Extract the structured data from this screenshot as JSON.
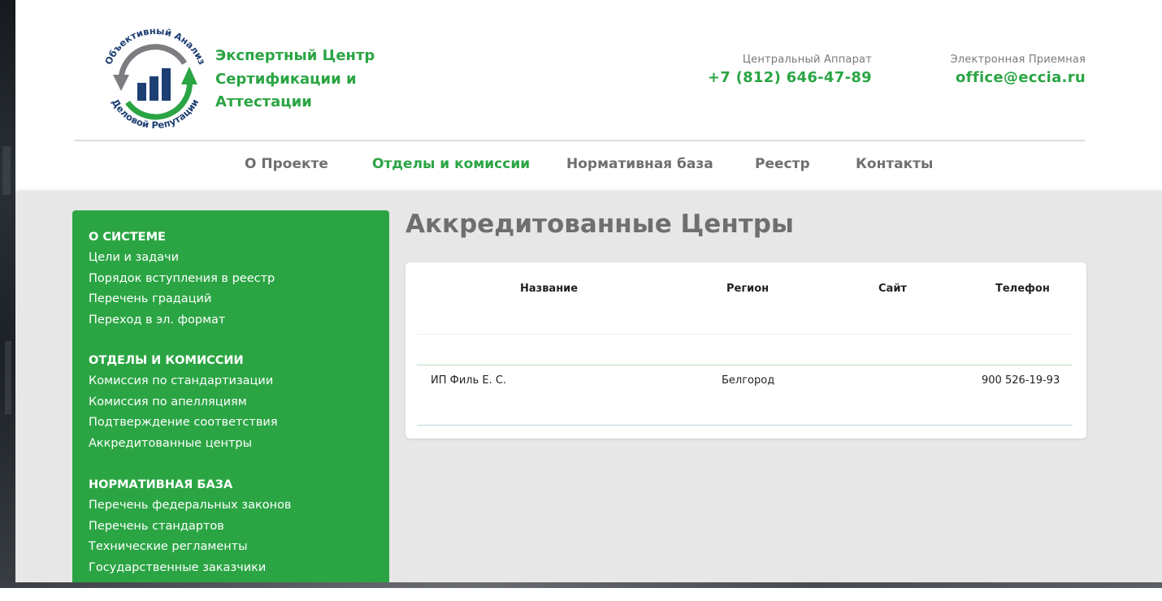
{
  "colors": {
    "brand_green": "#2ba544",
    "nav_gray": "#6f6f6f",
    "content_bg": "#e7e7e7"
  },
  "logo": {
    "icon": "circular-arrows-bar-chart-logo-icon",
    "ring_top_text": "Объективный Анализ",
    "ring_bottom_text": "Деловой Репутации"
  },
  "brand": {
    "line1": "Экспертный Центр",
    "line2": "Сертификации и",
    "line3": "Аттестации"
  },
  "contacts": {
    "phone_label": "Центральный Аппарат",
    "phone": "+7 (812) 646-47-89",
    "email_label": "Электронная Приемная",
    "email": "office@eccia.ru"
  },
  "nav": [
    {
      "label": "О Проекте",
      "active": false
    },
    {
      "label": "Отделы и комиссии",
      "active": true
    },
    {
      "label": "Нормативная база",
      "active": false
    },
    {
      "label": "Реестр",
      "active": false
    },
    {
      "label": "Контакты",
      "active": false
    }
  ],
  "sidebar": {
    "sections": [
      {
        "title": "О СИСТЕМЕ",
        "items": [
          "Цели и задачи",
          "Порядок вступления в реестр",
          "Перечень градаций",
          "Переход в эл. формат"
        ]
      },
      {
        "title": "ОТДЕЛЫ И КОМИССИИ",
        "items": [
          "Комиссия по стандартизации",
          "Комиссия по апелляциям",
          "Подтверждение соответствия",
          "Аккредитованные центры"
        ]
      },
      {
        "title": "НОРМАТИВНАЯ БАЗА",
        "items": [
          "Перечень федеральных законов",
          "Перечень стандартов",
          "Технические регламенты",
          "Государственные заказчики"
        ]
      }
    ]
  },
  "main": {
    "title": "Аккредитованные Центры",
    "table": {
      "headers": [
        "Название",
        "Регион",
        "Сайт",
        "Телефон"
      ],
      "rows": [
        [
          "ИП Филь Е. С.",
          "Белгород",
          "",
          "900 526-19-93"
        ]
      ]
    }
  }
}
